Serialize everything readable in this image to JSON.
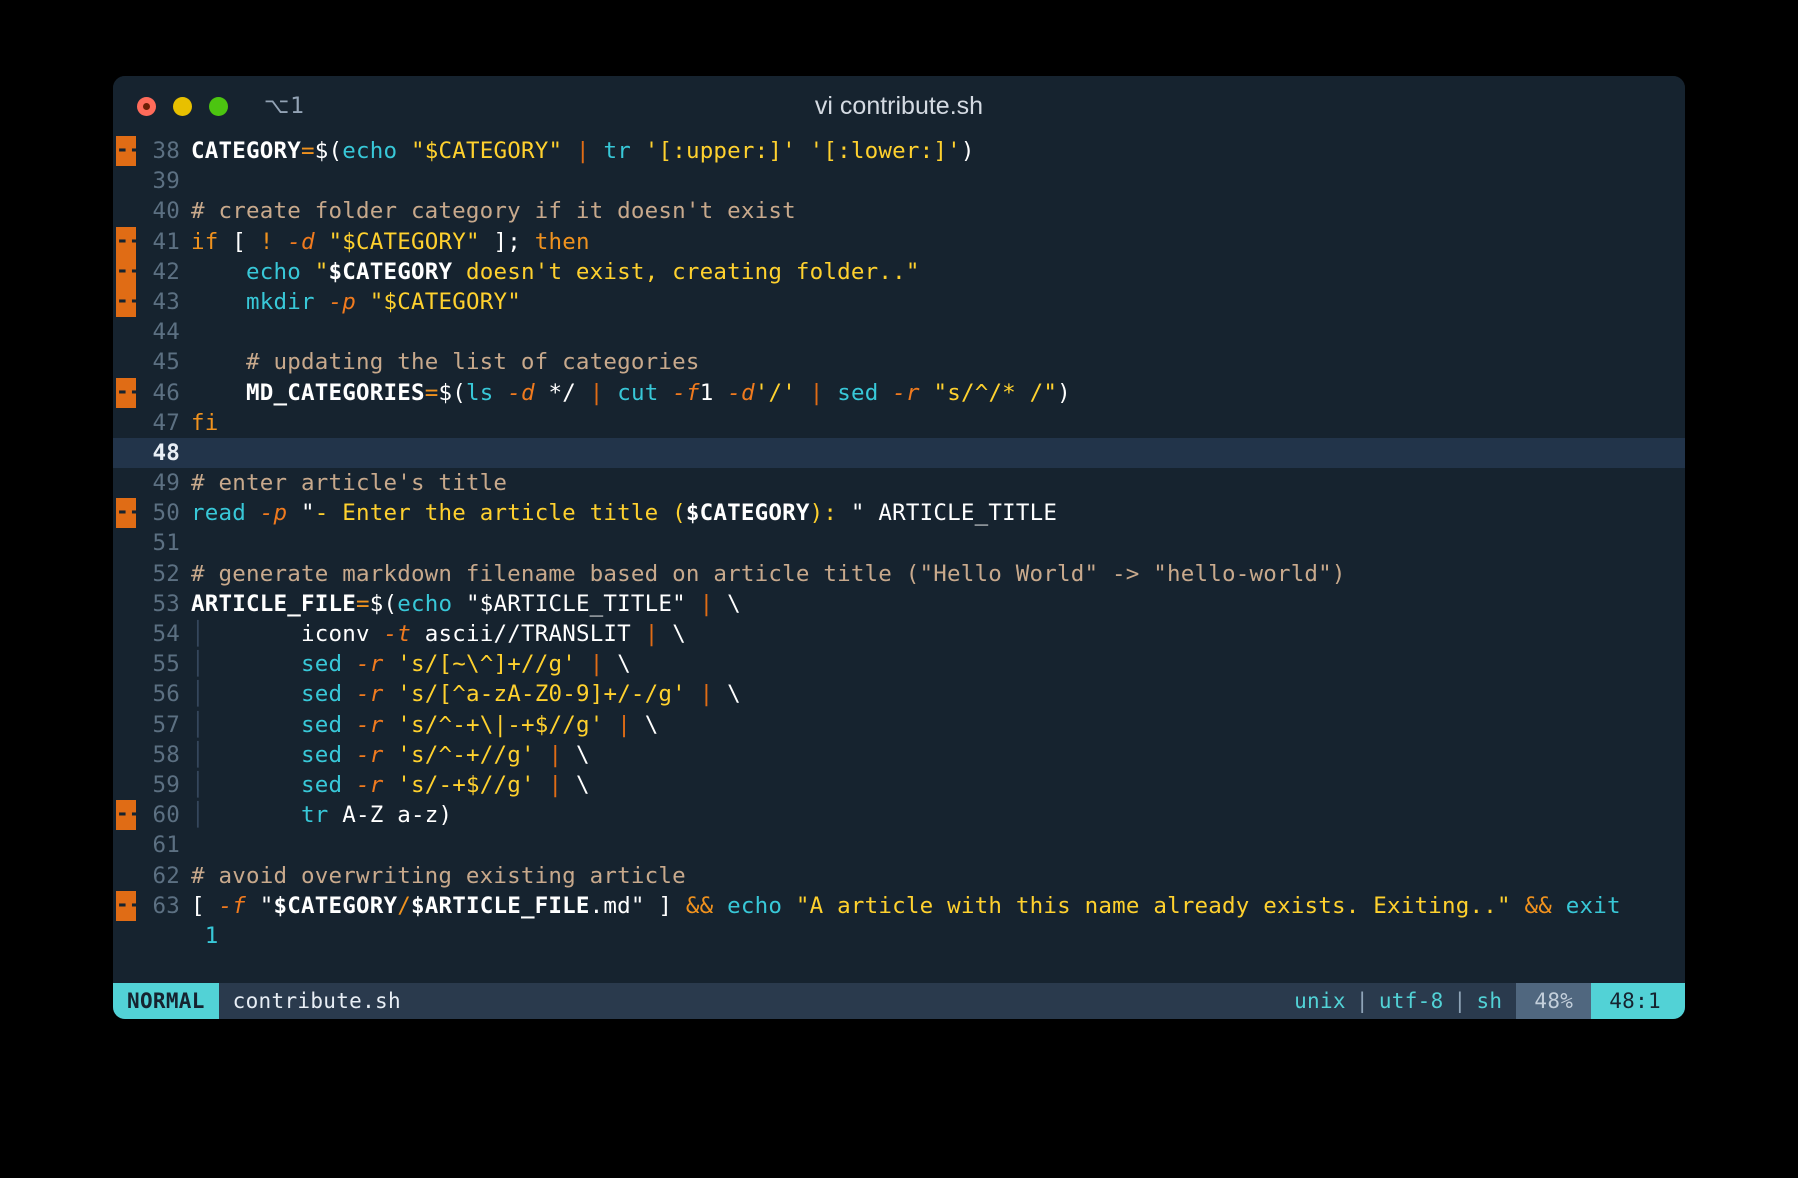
{
  "window": {
    "title": "vi contribute.sh",
    "tmux_indicator": "⌥1",
    "traffic_lights": [
      "close-red",
      "minimize-yellow",
      "maximize-green"
    ]
  },
  "colors": {
    "background": "#16232f",
    "cursorline": "#22344a",
    "sign_orange": "#e06c15",
    "accent_cyan": "#52d2d6",
    "string_yellow": "#ffd12e",
    "comment": "#c8a98c",
    "command_cyan": "#38c8d8",
    "keyword_orange": "#f0921e",
    "linenr": "#5c7082"
  },
  "editor": {
    "cursor_line_number": 48,
    "lines": [
      {
        "n": 38,
        "sign": true,
        "tokens": [
          {
            "t": "CATEGORY",
            "c": "c-var"
          },
          {
            "t": "=",
            "c": "c-op"
          },
          {
            "t": "$(",
            "c": "c-punct"
          },
          {
            "t": "echo",
            "c": "c-cmd"
          },
          {
            "t": " ",
            "c": "c-plain"
          },
          {
            "t": "\"$CATEGORY\"",
            "c": "c-str"
          },
          {
            "t": " ",
            "c": "c-plain"
          },
          {
            "t": "|",
            "c": "c-pipe"
          },
          {
            "t": " ",
            "c": "c-plain"
          },
          {
            "t": "tr",
            "c": "c-cmd"
          },
          {
            "t": " ",
            "c": "c-plain"
          },
          {
            "t": "'[:upper:]'",
            "c": "c-str"
          },
          {
            "t": " ",
            "c": "c-plain"
          },
          {
            "t": "'[:lower:]'",
            "c": "c-str"
          },
          {
            "t": ")",
            "c": "c-punct"
          }
        ]
      },
      {
        "n": 39,
        "sign": false,
        "tokens": []
      },
      {
        "n": 40,
        "sign": false,
        "tokens": [
          {
            "t": "# create folder category if it doesn't exist",
            "c": "c-comment"
          }
        ]
      },
      {
        "n": 41,
        "sign": true,
        "tokens": [
          {
            "t": "if",
            "c": "c-kw"
          },
          {
            "t": " ",
            "c": "c-plain"
          },
          {
            "t": "[",
            "c": "c-punct"
          },
          {
            "t": " ",
            "c": "c-plain"
          },
          {
            "t": "!",
            "c": "c-kw"
          },
          {
            "t": " ",
            "c": "c-plain"
          },
          {
            "t": "-d",
            "c": "c-flag"
          },
          {
            "t": " ",
            "c": "c-plain"
          },
          {
            "t": "\"$CATEGORY\"",
            "c": "c-str"
          },
          {
            "t": " ",
            "c": "c-plain"
          },
          {
            "t": "];",
            "c": "c-punct"
          },
          {
            "t": " ",
            "c": "c-plain"
          },
          {
            "t": "then",
            "c": "c-kw"
          }
        ]
      },
      {
        "n": 42,
        "sign": true,
        "tokens": [
          {
            "t": "    ",
            "c": "c-plain"
          },
          {
            "t": "echo",
            "c": "c-cmd"
          },
          {
            "t": " ",
            "c": "c-plain"
          },
          {
            "t": "\"",
            "c": "c-str"
          },
          {
            "t": "$CATEGORY",
            "c": "c-var"
          },
          {
            "t": " doesn't exist, creating folder..\"",
            "c": "c-str"
          }
        ]
      },
      {
        "n": 43,
        "sign": true,
        "tokens": [
          {
            "t": "    ",
            "c": "c-plain"
          },
          {
            "t": "mkdir",
            "c": "c-cmd"
          },
          {
            "t": " ",
            "c": "c-plain"
          },
          {
            "t": "-p",
            "c": "c-flag"
          },
          {
            "t": " ",
            "c": "c-plain"
          },
          {
            "t": "\"$CATEGORY\"",
            "c": "c-str"
          }
        ]
      },
      {
        "n": 44,
        "sign": false,
        "tokens": []
      },
      {
        "n": 45,
        "sign": false,
        "tokens": [
          {
            "t": "    ",
            "c": "c-plain"
          },
          {
            "t": "# updating the list of categories",
            "c": "c-comment"
          }
        ]
      },
      {
        "n": 46,
        "sign": true,
        "tokens": [
          {
            "t": "    ",
            "c": "c-plain"
          },
          {
            "t": "MD_CATEGORIES",
            "c": "c-var"
          },
          {
            "t": "=",
            "c": "c-op"
          },
          {
            "t": "$(",
            "c": "c-punct"
          },
          {
            "t": "ls",
            "c": "c-cmd"
          },
          {
            "t": " ",
            "c": "c-plain"
          },
          {
            "t": "-d",
            "c": "c-flag"
          },
          {
            "t": " ",
            "c": "c-plain"
          },
          {
            "t": "*/",
            "c": "c-plain"
          },
          {
            "t": " ",
            "c": "c-plain"
          },
          {
            "t": "|",
            "c": "c-pipe"
          },
          {
            "t": " ",
            "c": "c-plain"
          },
          {
            "t": "cut",
            "c": "c-cmd"
          },
          {
            "t": " ",
            "c": "c-plain"
          },
          {
            "t": "-f",
            "c": "c-flag"
          },
          {
            "t": "1",
            "c": "c-num"
          },
          {
            "t": " ",
            "c": "c-plain"
          },
          {
            "t": "-d",
            "c": "c-flag"
          },
          {
            "t": "'/'",
            "c": "c-str"
          },
          {
            "t": " ",
            "c": "c-plain"
          },
          {
            "t": "|",
            "c": "c-pipe"
          },
          {
            "t": " ",
            "c": "c-plain"
          },
          {
            "t": "sed",
            "c": "c-cmd"
          },
          {
            "t": " ",
            "c": "c-plain"
          },
          {
            "t": "-r",
            "c": "c-flag"
          },
          {
            "t": " ",
            "c": "c-plain"
          },
          {
            "t": "\"s/^/* /\"",
            "c": "c-str"
          },
          {
            "t": ")",
            "c": "c-punct"
          }
        ]
      },
      {
        "n": 47,
        "sign": false,
        "tokens": [
          {
            "t": "fi",
            "c": "c-kw"
          }
        ]
      },
      {
        "n": 48,
        "sign": false,
        "cursor": true,
        "tokens": []
      },
      {
        "n": 49,
        "sign": false,
        "tokens": [
          {
            "t": "# enter article's title",
            "c": "c-comment"
          }
        ]
      },
      {
        "n": 50,
        "sign": true,
        "tokens": [
          {
            "t": "read",
            "c": "c-cmd"
          },
          {
            "t": " ",
            "c": "c-plain"
          },
          {
            "t": "-p",
            "c": "c-flag"
          },
          {
            "t": " ",
            "c": "c-plain"
          },
          {
            "t": "\"",
            "c": "c-plain"
          },
          {
            "t": "- Enter the article title (",
            "c": "c-str"
          },
          {
            "t": "$CATEGORY",
            "c": "c-var"
          },
          {
            "t": ")",
            "c": "c-str"
          },
          {
            "t": ": ",
            "c": "c-str"
          },
          {
            "t": "\" ",
            "c": "c-plain"
          },
          {
            "t": "ARTICLE_TITLE",
            "c": "c-plain"
          }
        ]
      },
      {
        "n": 51,
        "sign": false,
        "tokens": []
      },
      {
        "n": 52,
        "sign": false,
        "tokens": [
          {
            "t": "# generate markdown filename based on article title (\"Hello World\" -> \"hello-world\")",
            "c": "c-comment"
          }
        ]
      },
      {
        "n": 53,
        "sign": false,
        "tokens": [
          {
            "t": "ARTICLE_FILE",
            "c": "c-var"
          },
          {
            "t": "=",
            "c": "c-op"
          },
          {
            "t": "$(",
            "c": "c-punct"
          },
          {
            "t": "echo",
            "c": "c-cmd"
          },
          {
            "t": " ",
            "c": "c-plain"
          },
          {
            "t": "\"$ARTICLE_TITLE\"",
            "c": "c-plain"
          },
          {
            "t": " ",
            "c": "c-plain"
          },
          {
            "t": "|",
            "c": "c-pipe"
          },
          {
            "t": " ",
            "c": "c-plain"
          },
          {
            "t": "\\",
            "c": "c-plain"
          }
        ]
      },
      {
        "n": 54,
        "sign": false,
        "guide": true,
        "tokens": [
          {
            "t": "iconv",
            "c": "c-plain"
          },
          {
            "t": " ",
            "c": "c-plain"
          },
          {
            "t": "-t",
            "c": "c-flag"
          },
          {
            "t": " ",
            "c": "c-plain"
          },
          {
            "t": "ascii//TRANSLIT",
            "c": "c-plain"
          },
          {
            "t": " ",
            "c": "c-plain"
          },
          {
            "t": "|",
            "c": "c-pipe"
          },
          {
            "t": " ",
            "c": "c-plain"
          },
          {
            "t": "\\",
            "c": "c-plain"
          }
        ]
      },
      {
        "n": 55,
        "sign": false,
        "guide": true,
        "tokens": [
          {
            "t": "sed",
            "c": "c-cmd"
          },
          {
            "t": " ",
            "c": "c-plain"
          },
          {
            "t": "-r",
            "c": "c-flag"
          },
          {
            "t": " ",
            "c": "c-plain"
          },
          {
            "t": "'s/[~\\^]+//g'",
            "c": "c-str"
          },
          {
            "t": " ",
            "c": "c-plain"
          },
          {
            "t": "|",
            "c": "c-pipe"
          },
          {
            "t": " ",
            "c": "c-plain"
          },
          {
            "t": "\\",
            "c": "c-plain"
          }
        ]
      },
      {
        "n": 56,
        "sign": false,
        "guide": true,
        "tokens": [
          {
            "t": "sed",
            "c": "c-cmd"
          },
          {
            "t": " ",
            "c": "c-plain"
          },
          {
            "t": "-r",
            "c": "c-flag"
          },
          {
            "t": " ",
            "c": "c-plain"
          },
          {
            "t": "'s/[^a-zA-Z0-9]+/-/g'",
            "c": "c-str"
          },
          {
            "t": " ",
            "c": "c-plain"
          },
          {
            "t": "|",
            "c": "c-pipe"
          },
          {
            "t": " ",
            "c": "c-plain"
          },
          {
            "t": "\\",
            "c": "c-plain"
          }
        ]
      },
      {
        "n": 57,
        "sign": false,
        "guide": true,
        "tokens": [
          {
            "t": "sed",
            "c": "c-cmd"
          },
          {
            "t": " ",
            "c": "c-plain"
          },
          {
            "t": "-r",
            "c": "c-flag"
          },
          {
            "t": " ",
            "c": "c-plain"
          },
          {
            "t": "'s/^-+\\|-+$//g'",
            "c": "c-str"
          },
          {
            "t": " ",
            "c": "c-plain"
          },
          {
            "t": "|",
            "c": "c-pipe"
          },
          {
            "t": " ",
            "c": "c-plain"
          },
          {
            "t": "\\",
            "c": "c-plain"
          }
        ]
      },
      {
        "n": 58,
        "sign": false,
        "guide": true,
        "tokens": [
          {
            "t": "sed",
            "c": "c-cmd"
          },
          {
            "t": " ",
            "c": "c-plain"
          },
          {
            "t": "-r",
            "c": "c-flag"
          },
          {
            "t": " ",
            "c": "c-plain"
          },
          {
            "t": "'s/^-+//g'",
            "c": "c-str"
          },
          {
            "t": " ",
            "c": "c-plain"
          },
          {
            "t": "|",
            "c": "c-pipe"
          },
          {
            "t": " ",
            "c": "c-plain"
          },
          {
            "t": "\\",
            "c": "c-plain"
          }
        ]
      },
      {
        "n": 59,
        "sign": false,
        "guide": true,
        "tokens": [
          {
            "t": "sed",
            "c": "c-cmd"
          },
          {
            "t": " ",
            "c": "c-plain"
          },
          {
            "t": "-r",
            "c": "c-flag"
          },
          {
            "t": " ",
            "c": "c-plain"
          },
          {
            "t": "'s/-+$//g'",
            "c": "c-str"
          },
          {
            "t": " ",
            "c": "c-plain"
          },
          {
            "t": "|",
            "c": "c-pipe"
          },
          {
            "t": " ",
            "c": "c-plain"
          },
          {
            "t": "\\",
            "c": "c-plain"
          }
        ]
      },
      {
        "n": 60,
        "sign": true,
        "guide": true,
        "tokens": [
          {
            "t": "tr",
            "c": "c-cmd"
          },
          {
            "t": " ",
            "c": "c-plain"
          },
          {
            "t": "A-Z a-z)",
            "c": "c-plain"
          }
        ]
      },
      {
        "n": 61,
        "sign": false,
        "tokens": []
      },
      {
        "n": 62,
        "sign": false,
        "tokens": [
          {
            "t": "# avoid overwriting existing article",
            "c": "c-comment"
          }
        ]
      },
      {
        "n": 63,
        "sign": true,
        "tokens": [
          {
            "t": "[",
            "c": "c-punct"
          },
          {
            "t": " ",
            "c": "c-plain"
          },
          {
            "t": "-f",
            "c": "c-flag"
          },
          {
            "t": " ",
            "c": "c-plain"
          },
          {
            "t": "\"",
            "c": "c-plain"
          },
          {
            "t": "$CATEGORY",
            "c": "c-var"
          },
          {
            "t": "/",
            "c": "c-op"
          },
          {
            "t": "$ARTICLE_FILE",
            "c": "c-var"
          },
          {
            "t": ".md\"",
            "c": "c-plain"
          },
          {
            "t": " ",
            "c": "c-plain"
          },
          {
            "t": "]",
            "c": "c-punct"
          },
          {
            "t": " ",
            "c": "c-plain"
          },
          {
            "t": "&&",
            "c": "c-op"
          },
          {
            "t": " ",
            "c": "c-plain"
          },
          {
            "t": "echo",
            "c": "c-cmd"
          },
          {
            "t": " ",
            "c": "c-plain"
          },
          {
            "t": "\"A article with this name already exists. Exiting..\"",
            "c": "c-str"
          },
          {
            "t": " ",
            "c": "c-plain"
          },
          {
            "t": "&&",
            "c": "c-op"
          },
          {
            "t": " ",
            "c": "c-plain"
          },
          {
            "t": "exit",
            "c": "c-cmd"
          }
        ]
      },
      {
        "n": "",
        "sign": false,
        "wrap": true,
        "tokens": [
          {
            "t": "1",
            "c": "c-cmd"
          }
        ]
      }
    ]
  },
  "statusline": {
    "mode": "NORMAL",
    "filename": "contribute.sh",
    "fileformat": "unix",
    "encoding": "utf-8",
    "filetype": "sh",
    "separator": "|",
    "percent": "48%",
    "position": "48:1"
  }
}
